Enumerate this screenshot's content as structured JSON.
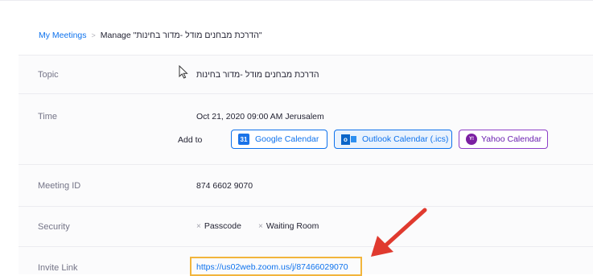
{
  "breadcrumb": {
    "my_meetings": "My Meetings",
    "separator": ">",
    "current": "Manage \"הדרכת מבחנים מודל -מדור בחינות\""
  },
  "topic": {
    "label": "Topic",
    "value": "הדרכת מבחנים מודל -מדור בחינות"
  },
  "time": {
    "label": "Time",
    "value": "Oct 21, 2020 09:00 AM Jerusalem",
    "add_to_label": "Add to",
    "calendars": {
      "google": {
        "label": "Google Calendar",
        "icon": "google-calendar-icon",
        "icon_text": "31"
      },
      "outlook": {
        "label": "Outlook Calendar (.ics)",
        "icon": "outlook-icon",
        "icon_text": "o"
      },
      "yahoo": {
        "label": "Yahoo Calendar",
        "icon": "yahoo-icon",
        "icon_text": "Y!"
      }
    }
  },
  "meeting_id": {
    "label": "Meeting ID",
    "value": "874 6602 9070"
  },
  "security": {
    "label": "Security",
    "items": [
      {
        "mark": "×",
        "label": "Passcode"
      },
      {
        "mark": "×",
        "label": "Waiting Room"
      }
    ]
  },
  "invite_link": {
    "label": "Invite Link",
    "value": "https://us02web.zoom.us/j/87466029070"
  },
  "colors": {
    "link": "#0e72ed",
    "highlight_box": "#f2b53c",
    "annotation_arrow": "#e03a2f",
    "yahoo": "#7b1fa2"
  }
}
